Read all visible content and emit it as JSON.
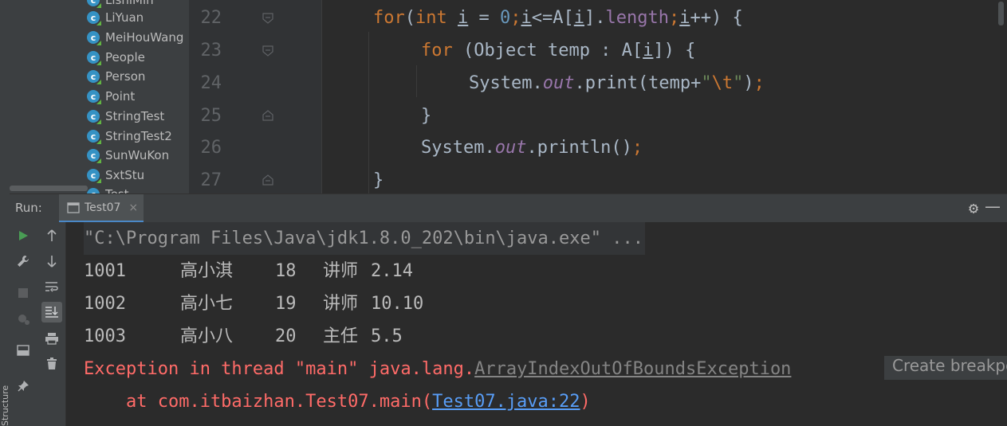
{
  "project_tree": {
    "items": [
      {
        "label": "LishiMin"
      },
      {
        "label": "LiYuan"
      },
      {
        "label": "MeiHouWang"
      },
      {
        "label": "People"
      },
      {
        "label": "Person"
      },
      {
        "label": "Point"
      },
      {
        "label": "StringTest"
      },
      {
        "label": "StringTest2"
      },
      {
        "label": "SunWuKon"
      },
      {
        "label": "SxtStu"
      },
      {
        "label": "Test"
      }
    ],
    "class_icon_glyph": "c"
  },
  "editor": {
    "line_numbers": [
      "22",
      "23",
      "24",
      "25",
      "26",
      "27"
    ],
    "lines": {
      "l22": {
        "kw_for": "for",
        "paren": "(",
        "kw_int": "int",
        "sp1": " ",
        "var_i": "i",
        "eq": " = ",
        "zero": "0",
        "semi1": ";",
        "var_i2": "i",
        "cmp": "<=A[",
        "var_i3": "i",
        "rb": "].",
        "length": "length",
        "semi2": ";",
        "var_i4": "i",
        "tail": "++) {"
      },
      "l23": {
        "kw_for": "for",
        "mid": " (Object temp : A[",
        "var_i": "i",
        "tail": "]) {"
      },
      "l24": {
        "sys": "System.",
        "out": "out",
        "print": ".print(temp+",
        "q1": "\"",
        "esc": "\\t",
        "q2": "\"",
        "close": ")",
        "semi": ";"
      },
      "l25": {
        "text": "}"
      },
      "l26": {
        "sys": "System.",
        "out": "out",
        "rest": ".println()",
        "semi": ";"
      },
      "l27": {
        "text": "}"
      }
    }
  },
  "run_window": {
    "title": "Run:",
    "tab_label": "Test07",
    "tab_close": "×"
  },
  "console": {
    "cmd": "\"C:\\Program Files\\Java\\jdk1.8.0_202\\bin\\java.exe\" ...",
    "rows": [
      {
        "id": "1001",
        "name": "高小淇",
        "age": "18",
        "title": "讲师",
        "salary": "2.14"
      },
      {
        "id": "1002",
        "name": "高小七",
        "age": "19",
        "title": "讲师",
        "salary": "10.10"
      },
      {
        "id": "1003",
        "name": "高小八",
        "age": "20",
        "title": "主任",
        "salary": "5.5"
      }
    ],
    "exception_prefix": "Exception in thread \"main\" java.lang.",
    "exception_class": "ArrayIndexOutOfBoundsException",
    "stack_prefix": "    at com.itbaizhan.Test07.main(",
    "stack_link": "Test07.java:22",
    "stack_suffix": ")",
    "create_breakpoint": "Create breakpoint"
  },
  "side_tab": {
    "label": "Structure"
  },
  "colors": {
    "keyword": "#cc7832",
    "number": "#6897bb",
    "field": "#9876aa",
    "error": "#ff6b68",
    "link": "#589df6",
    "run_green": "#499c54"
  }
}
